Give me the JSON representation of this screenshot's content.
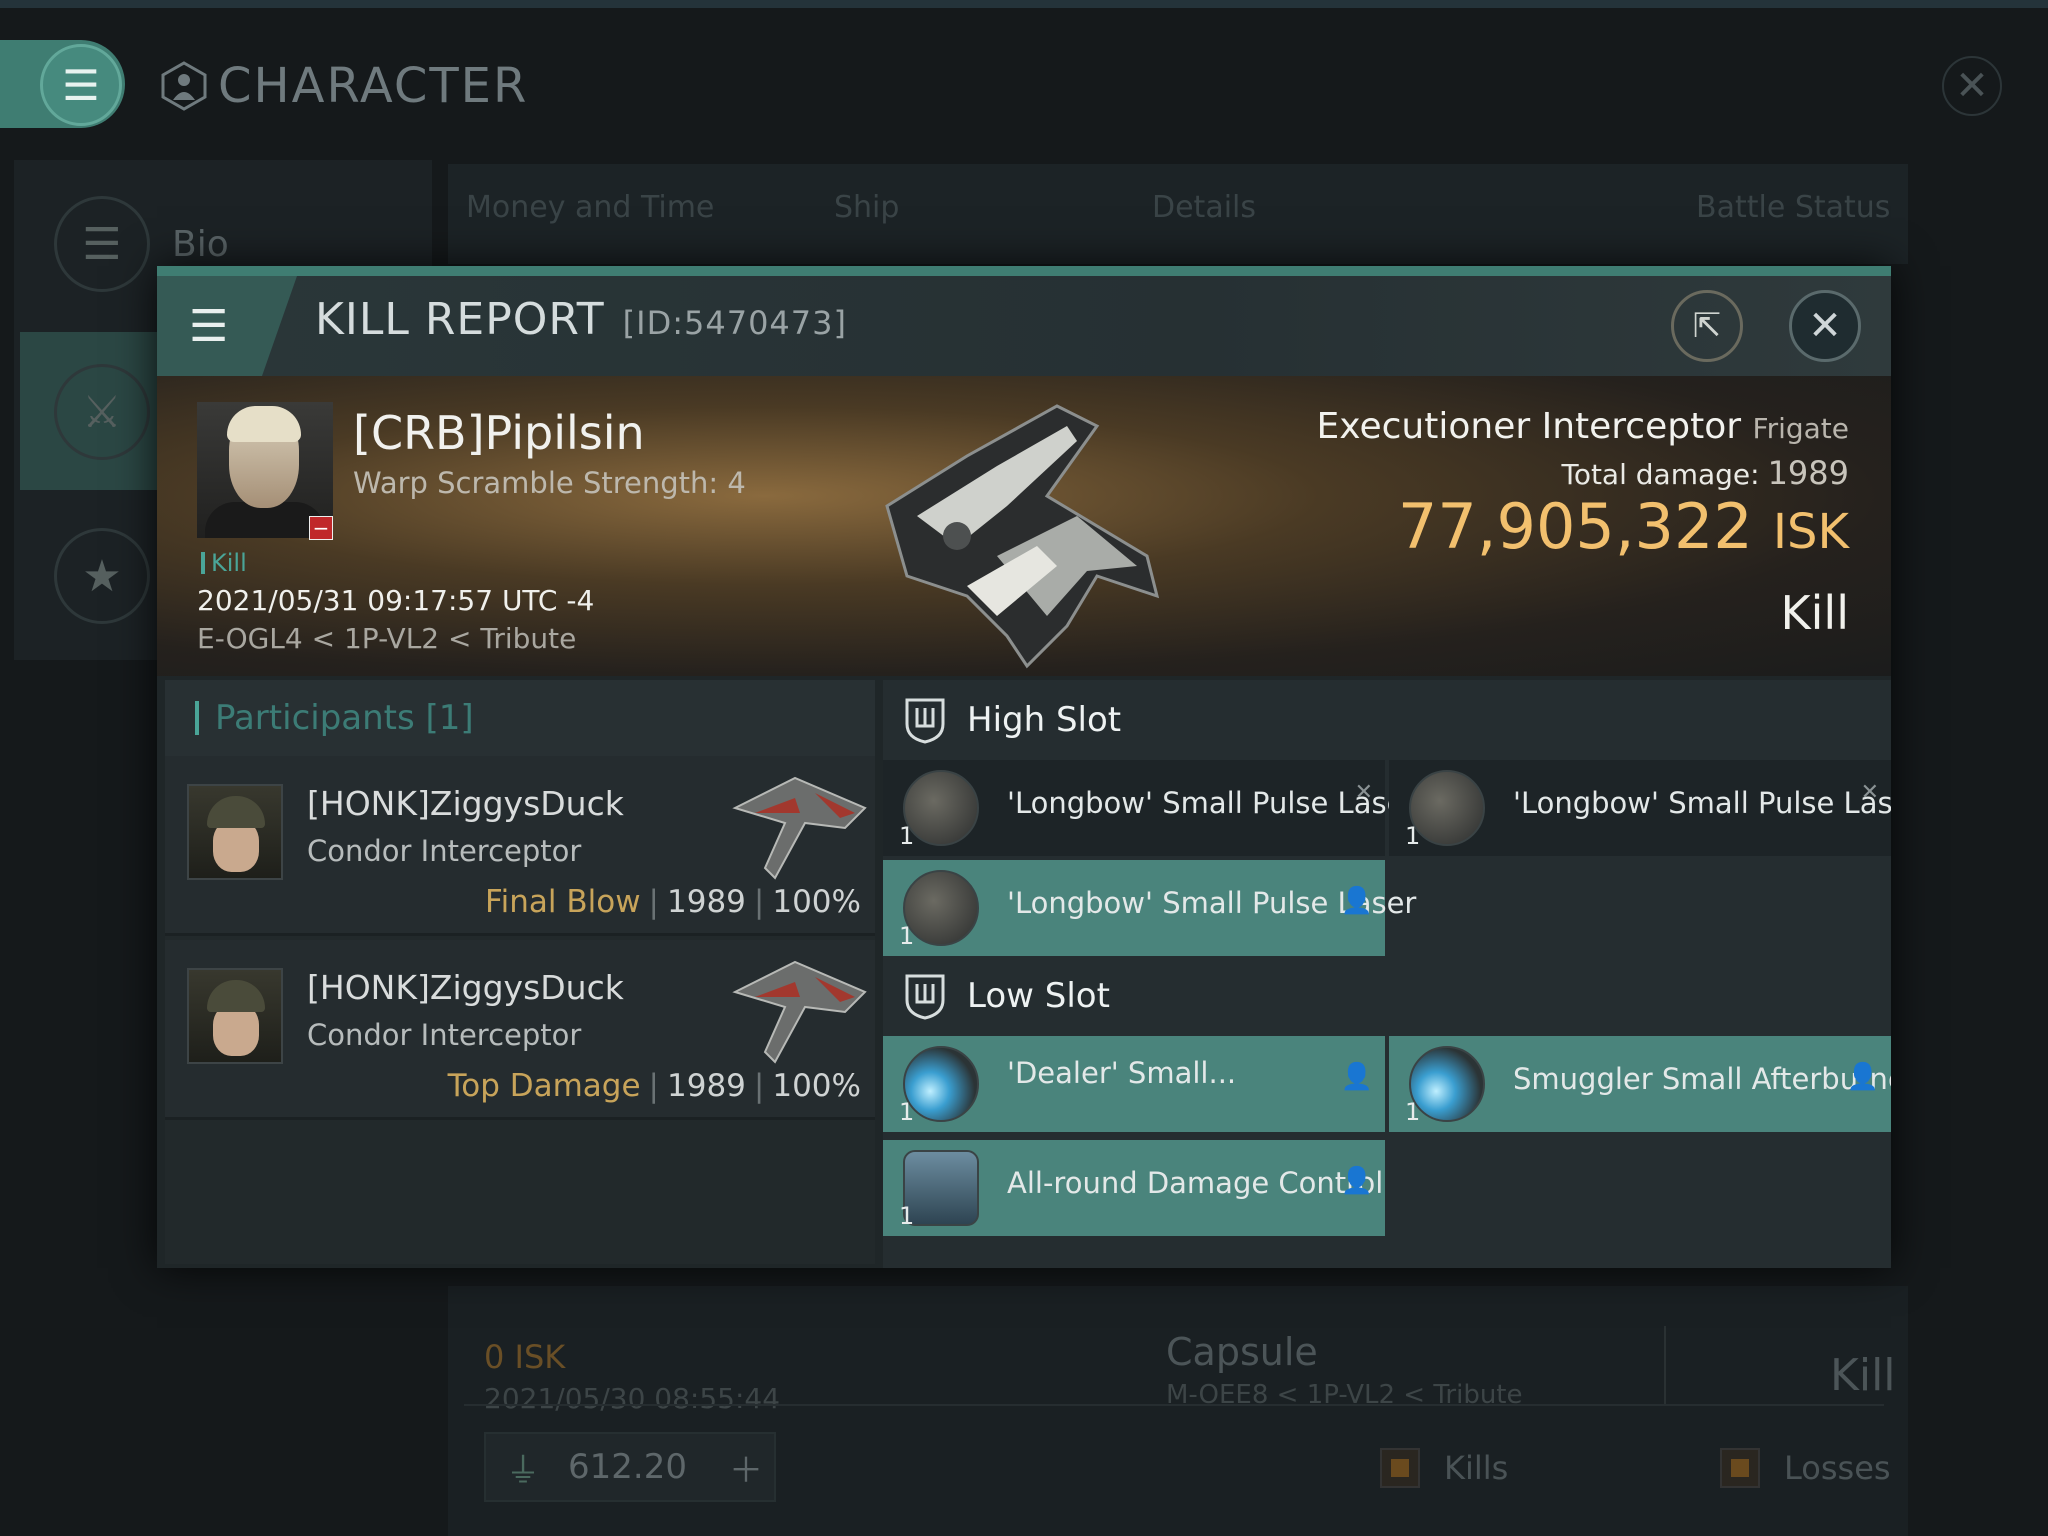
{
  "app": {
    "title": "CHARACTER",
    "sidebar": {
      "bio_label": "Bio"
    },
    "tabs": [
      "Money and Time",
      "Ship",
      "Details",
      "Battle Status"
    ],
    "background_row": {
      "isk": "0  ISK",
      "date": "2021/05/30  08:55:44",
      "ship": "Capsule",
      "location": "M-OEE8 < 1P-VL2 < Tribute",
      "result": "Kill"
    },
    "footer": {
      "balance": "612.20",
      "legend_kills": "Kills",
      "legend_losses": "Losses"
    }
  },
  "modal": {
    "title": "KILL REPORT",
    "id_label": "[ID:5470473]",
    "victim": {
      "name": "[CRB]Pipilsin",
      "subtitle": "Warp Scramble Strength: 4",
      "tag": "Kill",
      "datetime": "2021/05/31 09:17:57 UTC -4",
      "location": "E-OGL4 < 1P-VL2 < Tribute"
    },
    "ship": {
      "name": "Executioner Interceptor",
      "class": "Frigate",
      "total_damage_label": "Total damage:",
      "total_damage": "1989",
      "isk_value": "77,905,322",
      "isk_unit": "ISK",
      "result": "Kill"
    },
    "participants": {
      "header": "Participants [1]",
      "rows": [
        {
          "name": "[HONK]ZiggysDuck",
          "ship": "Condor Interceptor",
          "label": "Final Blow",
          "damage": "1989",
          "percent": "100%"
        },
        {
          "name": "[HONK]ZiggysDuck",
          "ship": "Condor Interceptor",
          "label": "Top Damage",
          "damage": "1989",
          "percent": "100%"
        }
      ]
    },
    "slots": {
      "high": {
        "title": "High Slot",
        "modules": [
          {
            "name": "'Longbow' Small Pulse Laser",
            "qty": "1",
            "icon": "pulse-laser-icon",
            "state": "destroyed"
          },
          {
            "name": "'Longbow' Small Pulse Laser",
            "qty": "1",
            "icon": "pulse-laser-icon",
            "state": "destroyed"
          },
          {
            "name": "'Longbow' Small Pulse Laser",
            "qty": "1",
            "icon": "pulse-laser-icon",
            "state": "dropped"
          }
        ]
      },
      "low": {
        "title": "Low Slot",
        "modules": [
          {
            "name": "'Dealer' Small...",
            "qty": "1",
            "icon": "afterburner-icon",
            "state": "dropped"
          },
          {
            "name": "Smuggler Small Afterburner",
            "qty": "1",
            "icon": "afterburner-icon",
            "state": "dropped"
          },
          {
            "name": "All-round Damage Control",
            "qty": "1",
            "icon": "damage-control-icon",
            "state": "dropped"
          }
        ]
      }
    }
  },
  "colors": {
    "accent": "#3f7d72",
    "isk": "#f2c06e",
    "fitted_module": "#4a847c",
    "participant_label": "#c8a45a"
  }
}
